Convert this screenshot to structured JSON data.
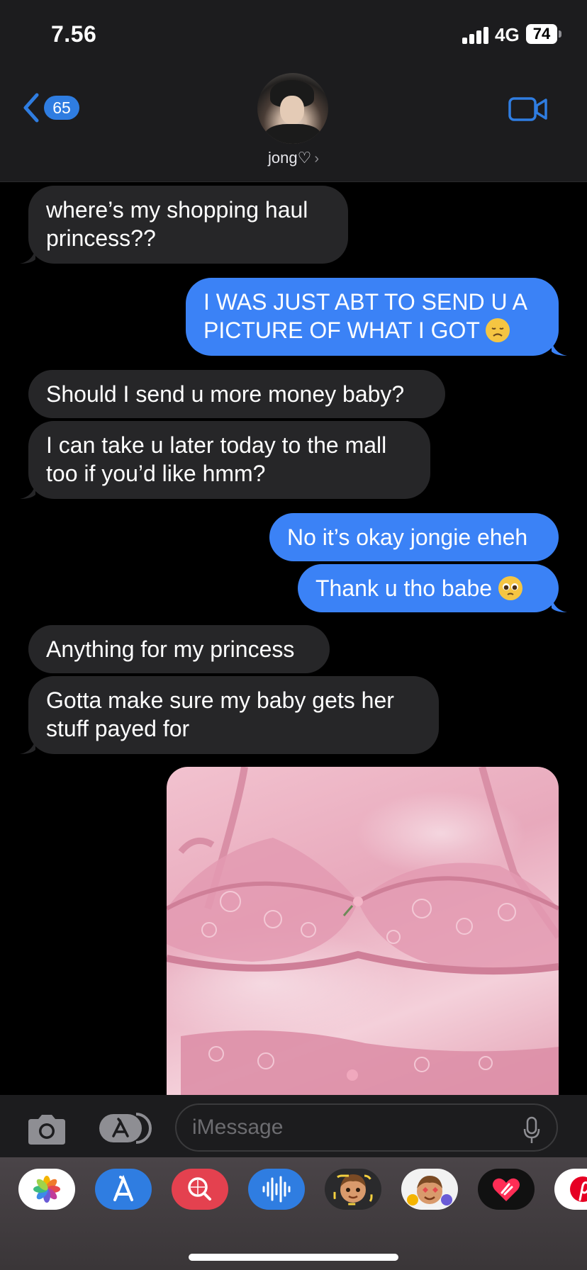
{
  "status_bar": {
    "time": "7.56",
    "network": "4G",
    "battery": "74"
  },
  "header": {
    "back_count": "65",
    "contact_name": "jong♡",
    "contact_chevron": "›"
  },
  "messages": [
    {
      "direction": "incoming",
      "text": "where’s my shopping haul princess??"
    },
    {
      "direction": "outgoing",
      "text": "I WAS JUST ABT TO SEND U A PICTURE OF WHAT I GOT",
      "emoji": "disappointed-face"
    },
    {
      "direction": "incoming",
      "text": "Should I send u more money baby?"
    },
    {
      "direction": "incoming",
      "text": "I can take u later today to the mall too if you’d like hmm?"
    },
    {
      "direction": "outgoing",
      "text": "No it’s okay jongie eheh"
    },
    {
      "direction": "outgoing",
      "text": "Thank u tho babe",
      "emoji": "pleading-face"
    },
    {
      "direction": "incoming",
      "text": "Anything for my princess"
    },
    {
      "direction": "incoming",
      "text": "Gotta make sure my baby gets her stuff payed for"
    },
    {
      "direction": "outgoing",
      "type": "photo",
      "image": "pink-lace-lingerie-photo"
    }
  ],
  "composer": {
    "placeholder": "iMessage"
  },
  "app_drawer": {
    "apps": [
      "photos-app-icon",
      "app-store-icon",
      "images-search-icon",
      "audio-message-icon",
      "memoji-icon",
      "animoji-stickers-icon",
      "digital-touch-icon",
      "pinterest-icon"
    ]
  },
  "colors": {
    "accent": "#3b82f6",
    "incoming_bubble": "#262628",
    "header_bg": "#1c1c1e"
  }
}
